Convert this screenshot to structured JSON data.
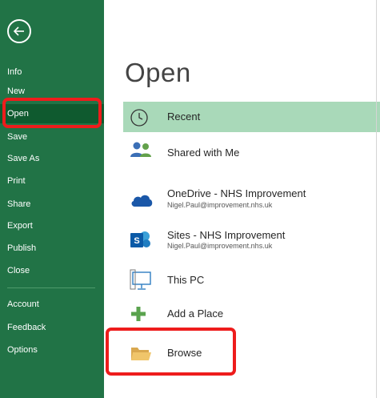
{
  "sidebar": {
    "items": [
      {
        "label": "Info"
      },
      {
        "label": "New"
      },
      {
        "label": "Open"
      },
      {
        "label": "Save"
      },
      {
        "label": "Save As"
      },
      {
        "label": "Print"
      },
      {
        "label": "Share"
      },
      {
        "label": "Export"
      },
      {
        "label": "Publish"
      },
      {
        "label": "Close"
      },
      {
        "label": "Account"
      },
      {
        "label": "Feedback"
      },
      {
        "label": "Options"
      }
    ],
    "active": "Open"
  },
  "main": {
    "title": "Open",
    "places": [
      {
        "label": "Recent",
        "icon": "clock-icon",
        "selected": true
      },
      {
        "label": "Shared with Me",
        "icon": "people-icon"
      },
      {
        "label": "OneDrive - NHS Improvement",
        "sub": "Nigel.Paul@improvement.nhs.uk",
        "icon": "cloud-icon"
      },
      {
        "label": "Sites - NHS Improvement",
        "sub": "Nigel.Paul@improvement.nhs.uk",
        "icon": "sharepoint-icon"
      },
      {
        "label": "This PC",
        "icon": "computer-icon"
      },
      {
        "label": "Add a Place",
        "icon": "plus-icon"
      },
      {
        "label": "Browse",
        "icon": "folder-icon"
      }
    ]
  },
  "colors": {
    "sidebar_bg": "#217346",
    "sidebar_active": "#0f5a2f",
    "selected_row": "#a9d9b9",
    "highlight_red": "#ee1c1c"
  }
}
